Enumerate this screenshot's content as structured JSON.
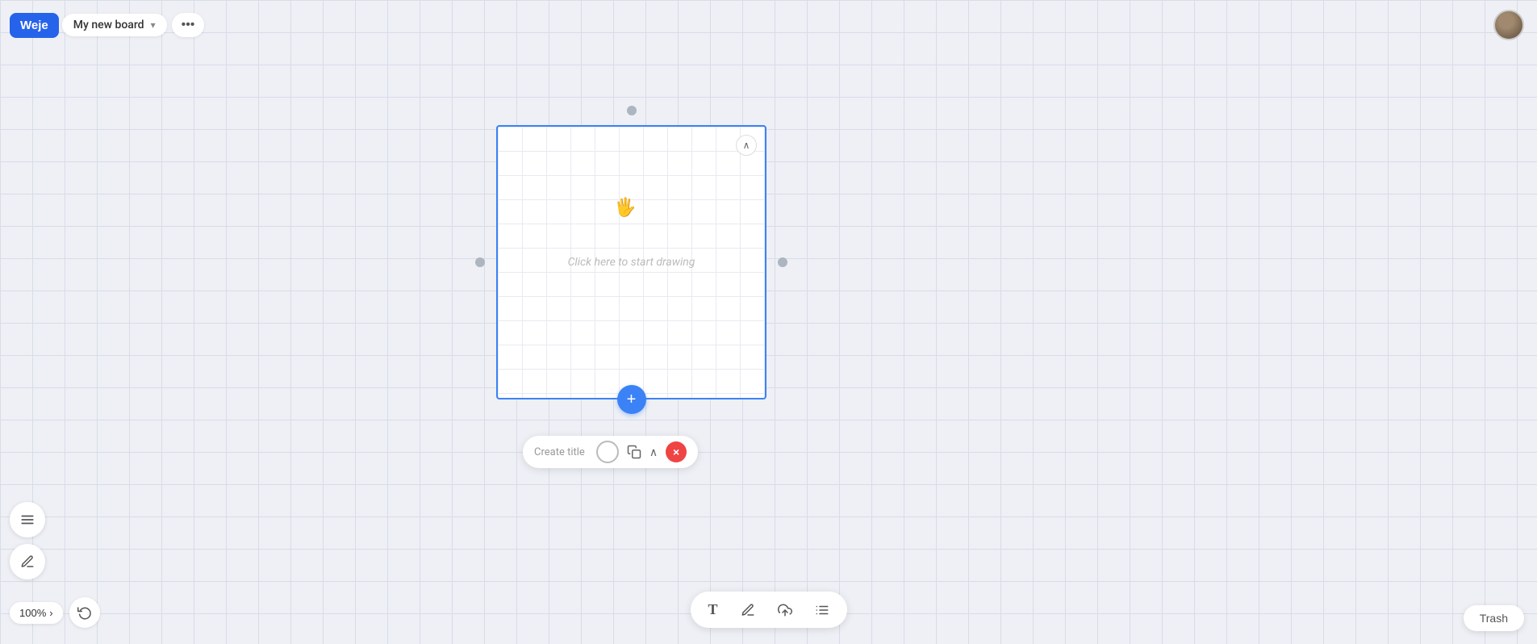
{
  "app": {
    "logo": "Weje",
    "board_title": "My new board",
    "more_icon": "•••"
  },
  "canvas": {
    "placeholder": "Click here to start drawing",
    "zoom_level": "100%"
  },
  "title_toolbar": {
    "create_title_label": "Create title",
    "circle_btn_label": "color-picker",
    "copy_btn_label": "duplicate",
    "chevron_up_label": "collapse",
    "close_btn_label": "×"
  },
  "bottom_toolbar": {
    "text_icon": "T",
    "pen_icon": "✏",
    "upload_icon": "↑",
    "list_icon": "≡"
  },
  "trash": {
    "label": "Trash"
  },
  "tools": {
    "menu_icon": "☰",
    "pen_icon": "✏"
  },
  "zoom": {
    "value": "100%",
    "chevron": "›"
  }
}
